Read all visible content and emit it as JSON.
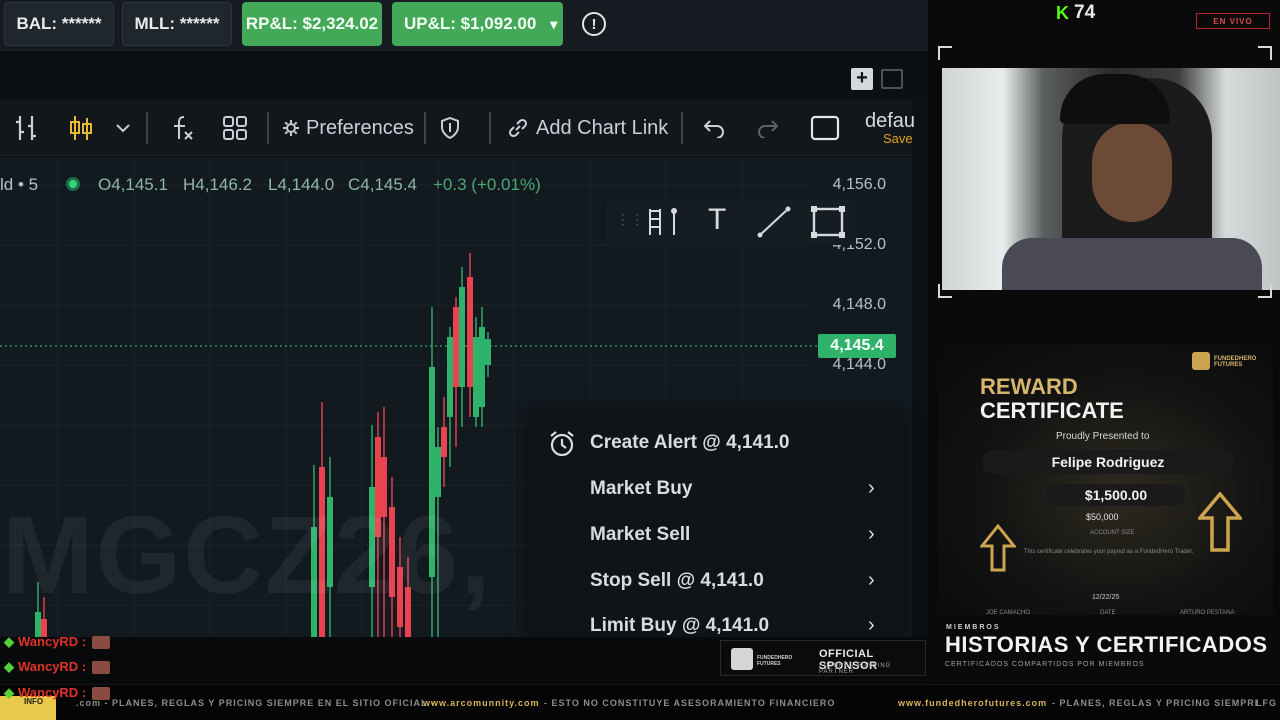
{
  "topbar": {
    "balance": "BAL: ******",
    "mll": "MLL: ******",
    "rpl": "RP&L: $2,324.02",
    "upl": "UP&L: $1,092.00",
    "upl_arrow": "▾",
    "alert_glyph": "!"
  },
  "toolbar": {
    "preferences": "Preferences",
    "add_chart_link": "Add Chart Link",
    "layout_name": "defau",
    "save_label": "Save"
  },
  "chart": {
    "ohlc_prefix": "ld • 5",
    "open": "O4,145.1",
    "high": "H4,146.2",
    "low": "L4,144.0",
    "close": "C4,145.4",
    "change": "+0.3 (+0.01%)",
    "watermark": "MGCZ26,",
    "price_labels": [
      "4,156.0",
      "4,152.0",
      "4,148.0",
      "4,144.0"
    ],
    "current_price": "4,145.4"
  },
  "context_menu": {
    "create_alert": "Create Alert @ 4,141.0",
    "market_buy": "Market Buy",
    "market_sell": "Market Sell",
    "stop_sell": "Stop Sell @ 4,141.0",
    "limit_buy": "Limit Buy @ 4,141.0"
  },
  "stream": {
    "viewer_count": "74",
    "live_badge": "EN VIVO",
    "cert_title_1": "REWARD",
    "cert_title_2": "CERTIFICATE",
    "cert_presented": "Proudly Presented to",
    "cert_name": "Felipe Rodriguez",
    "cert_amount": "$1,500.00",
    "cert_account": "$50,000",
    "cert_account_label": "ACCOUNT SIZE",
    "cert_body": "This certificate celebrates your payout as a FundedHero Trader.",
    "cert_date": "12/22/25",
    "cert_sig_left": "JOE CAMACHO",
    "cert_sig_mid": "DATE",
    "cert_sig_right": "ARTURO PESTANA",
    "cert_brand": "FUNDEDHERO FUTURES",
    "members_small": "MIEMBROS",
    "members_title": "HISTORIAS Y CERTIFICADOS",
    "members_sub": "CERTIFICADOS COMPARTIDOS POR MIEMBROS"
  },
  "chat": {
    "username": "WancyRD"
  },
  "sponsor": {
    "title": "OFFICIAL SPONSOR",
    "subtitle": "FUTURES FUNDING PARTNER",
    "brand": "FUNDEDHERO FUTURES"
  },
  "ticker": {
    "left": "INFO",
    "seg1": ".com  -  PLANES, REGLAS Y PRICING SIEMPRE EN EL SITIO OFICIAL  -",
    "seg2_hl": "www.arcomunnity.com",
    "seg2": "-  ESTO NO CONSTITUYE ASESORAMIENTO FINANCIERO",
    "seg3_hl": "www.fundedherofutures.com",
    "seg3": "-  PLANES, REGLAS Y PRICING SIEMPRI",
    "right": "LFG"
  },
  "colors": {
    "up": "#2fb36b",
    "down": "#e9434f",
    "accent_green": "#43a857",
    "gold": "#d6b66b",
    "kick_green": "#53fc18"
  }
}
